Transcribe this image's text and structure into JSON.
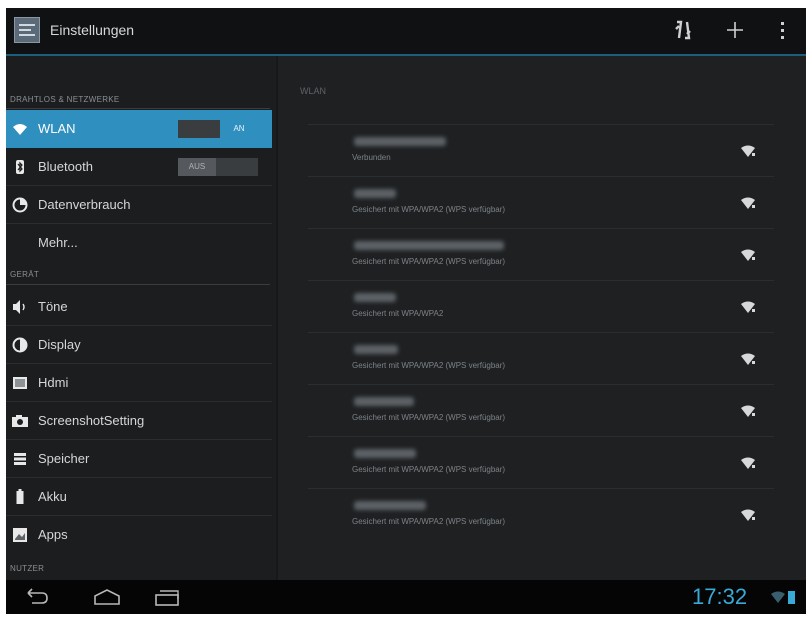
{
  "action_bar": {
    "title": "Einstellungen",
    "icons": [
      "settings-app-icon",
      "sync-icon",
      "add-icon",
      "overflow-menu-icon"
    ]
  },
  "sidebar": {
    "sections": [
      {
        "label": "DRAHTLOS & NETZWERKE"
      },
      {
        "label": "GERÄT"
      },
      {
        "label": "NUTZER"
      }
    ],
    "items": [
      {
        "label": "WLAN",
        "icon": "wifi-icon",
        "toggle": "AN",
        "selected": true
      },
      {
        "label": "Bluetooth",
        "icon": "bluetooth-icon",
        "toggle": "AUS"
      },
      {
        "label": "Datenverbrauch",
        "icon": "data-usage-icon"
      },
      {
        "label": "Mehr..."
      },
      {
        "label": "Töne",
        "icon": "volume-icon"
      },
      {
        "label": "Display",
        "icon": "brightness-icon"
      },
      {
        "label": "Hdmi",
        "icon": "hdmi-icon"
      },
      {
        "label": "ScreenshotSetting",
        "icon": "camera-icon"
      },
      {
        "label": "Speicher",
        "icon": "storage-icon"
      },
      {
        "label": "Akku",
        "icon": "battery-icon"
      },
      {
        "label": "Apps",
        "icon": "apps-icon"
      }
    ]
  },
  "wlan": {
    "header": "WLAN",
    "networks": [
      {
        "status": "Verbunden"
      },
      {
        "status": "Gesichert mit WPA/WPA2 (WPS verfügbar)"
      },
      {
        "status": "Gesichert mit WPA/WPA2 (WPS verfügbar)"
      },
      {
        "status": "Gesichert mit WPA/WPA2"
      },
      {
        "status": "Gesichert mit WPA/WPA2 (WPS verfügbar)"
      },
      {
        "status": "Gesichert mit WPA/WPA2 (WPS verfügbar)"
      },
      {
        "status": "Gesichert mit WPA/WPA2 (WPS verfügbar)"
      },
      {
        "status": "Gesichert mit WPA/WPA2 (WPS verfügbar)"
      }
    ]
  },
  "status_bar": {
    "time": "17:32",
    "nav_icons": [
      "back-icon",
      "home-icon",
      "recent-apps-icon"
    ],
    "status_icons": [
      "wifi-signal-icon",
      "battery-icon"
    ]
  },
  "colors": {
    "accent": "#2f8fbf",
    "clock": "#39a9d6",
    "background": "#1c1d1f"
  }
}
